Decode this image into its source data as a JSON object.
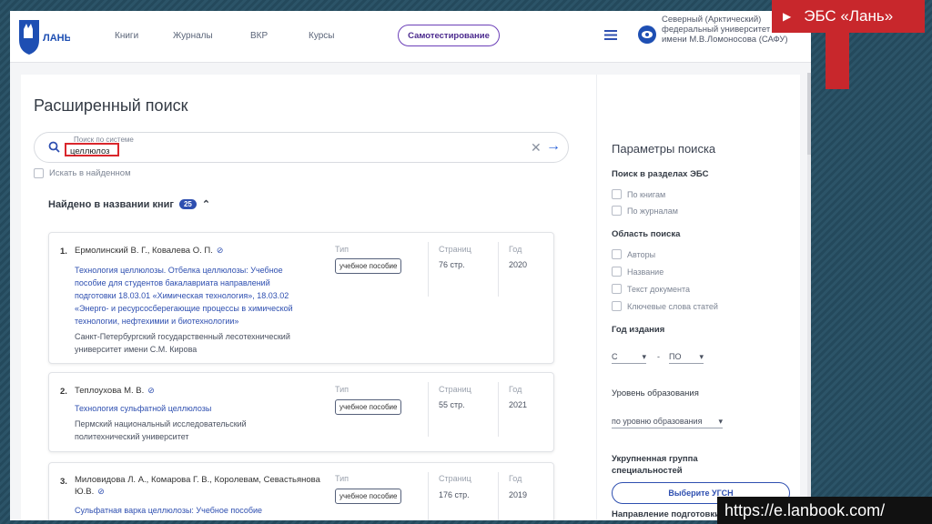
{
  "header": {
    "logo_text": "ЛАНЬ",
    "nav": [
      "Книги",
      "Журналы",
      "ВКР",
      "Курсы"
    ],
    "selftest_label": "Самотестирование",
    "org": "Северный (Арктический) федеральный университет имени М.В.Ломоносова (САФУ)"
  },
  "page": {
    "title": "Расширенный поиск",
    "search_label": "Поиск по системе",
    "search_value": "целлюлоз",
    "within_found": "Искать в найденном",
    "found_title": "Найдено в названии книг",
    "found_count": "25",
    "col_labels": {
      "type": "Тип",
      "pages": "Страниц",
      "year": "Год"
    }
  },
  "results": [
    {
      "num": "1.",
      "authors": "Ермолинский В. Г., Ковалева О. П.",
      "title": "Технология целлюлозы. Отбелка целлюлозы: Учебное пособие для студентов бакалавриата направлений подготовки 18.03.01 «Химическая технология», 18.03.02 «Энерго- и ресурсосберегающие процессы в химической технологии, нефтехимии и биотехнологии»",
      "publisher": "Санкт-Петербургский государственный лесотехнический университет имени С.М. Кирова",
      "type": "учебное пособие",
      "pages": "76 стр.",
      "year": "2020"
    },
    {
      "num": "2.",
      "authors": "Теплоухова М. В.",
      "title": "Технология сульфатной целлюлозы",
      "publisher": "Пермский национальный исследовательский политехнический университет",
      "type": "учебное пособие",
      "pages": "55 стр.",
      "year": "2021"
    },
    {
      "num": "3.",
      "authors": "Миловидова Л. А., Комарова Г. В., Королевам, Севастьянова Ю.В.",
      "title": "Сульфатная варка целлюлозы: Учебное пособие",
      "publisher": "",
      "type": "учебное пособие",
      "pages": "176 стр.",
      "year": "2019"
    }
  ],
  "params": {
    "title": "Параметры поиска",
    "sections_head": "Поиск в разделах ЭБС",
    "sections": [
      "По книгам",
      "По журналам"
    ],
    "area_head": "Область поиска",
    "area": [
      "Авторы",
      "Название",
      "Текст документа",
      "Ключевые слова статей"
    ],
    "year_head": "Год издания",
    "year_from": "С",
    "year_sep": "-",
    "year_to": "ПО",
    "level_head": "Уровень образования",
    "level_value": "по уровню образования",
    "ugsn_head": "Укрупненная группа специальностей",
    "ugsn_button": "Выберите УГСН",
    "direction_head": "Направление подготовки"
  },
  "overlay": {
    "ebs_label": "ЭБС «Лань»",
    "url": "https://e.lanbook.com/"
  },
  "colors": {
    "accent": "#2e4fb0",
    "brand_red": "#c8272c",
    "purple": "#6b3fb8"
  }
}
